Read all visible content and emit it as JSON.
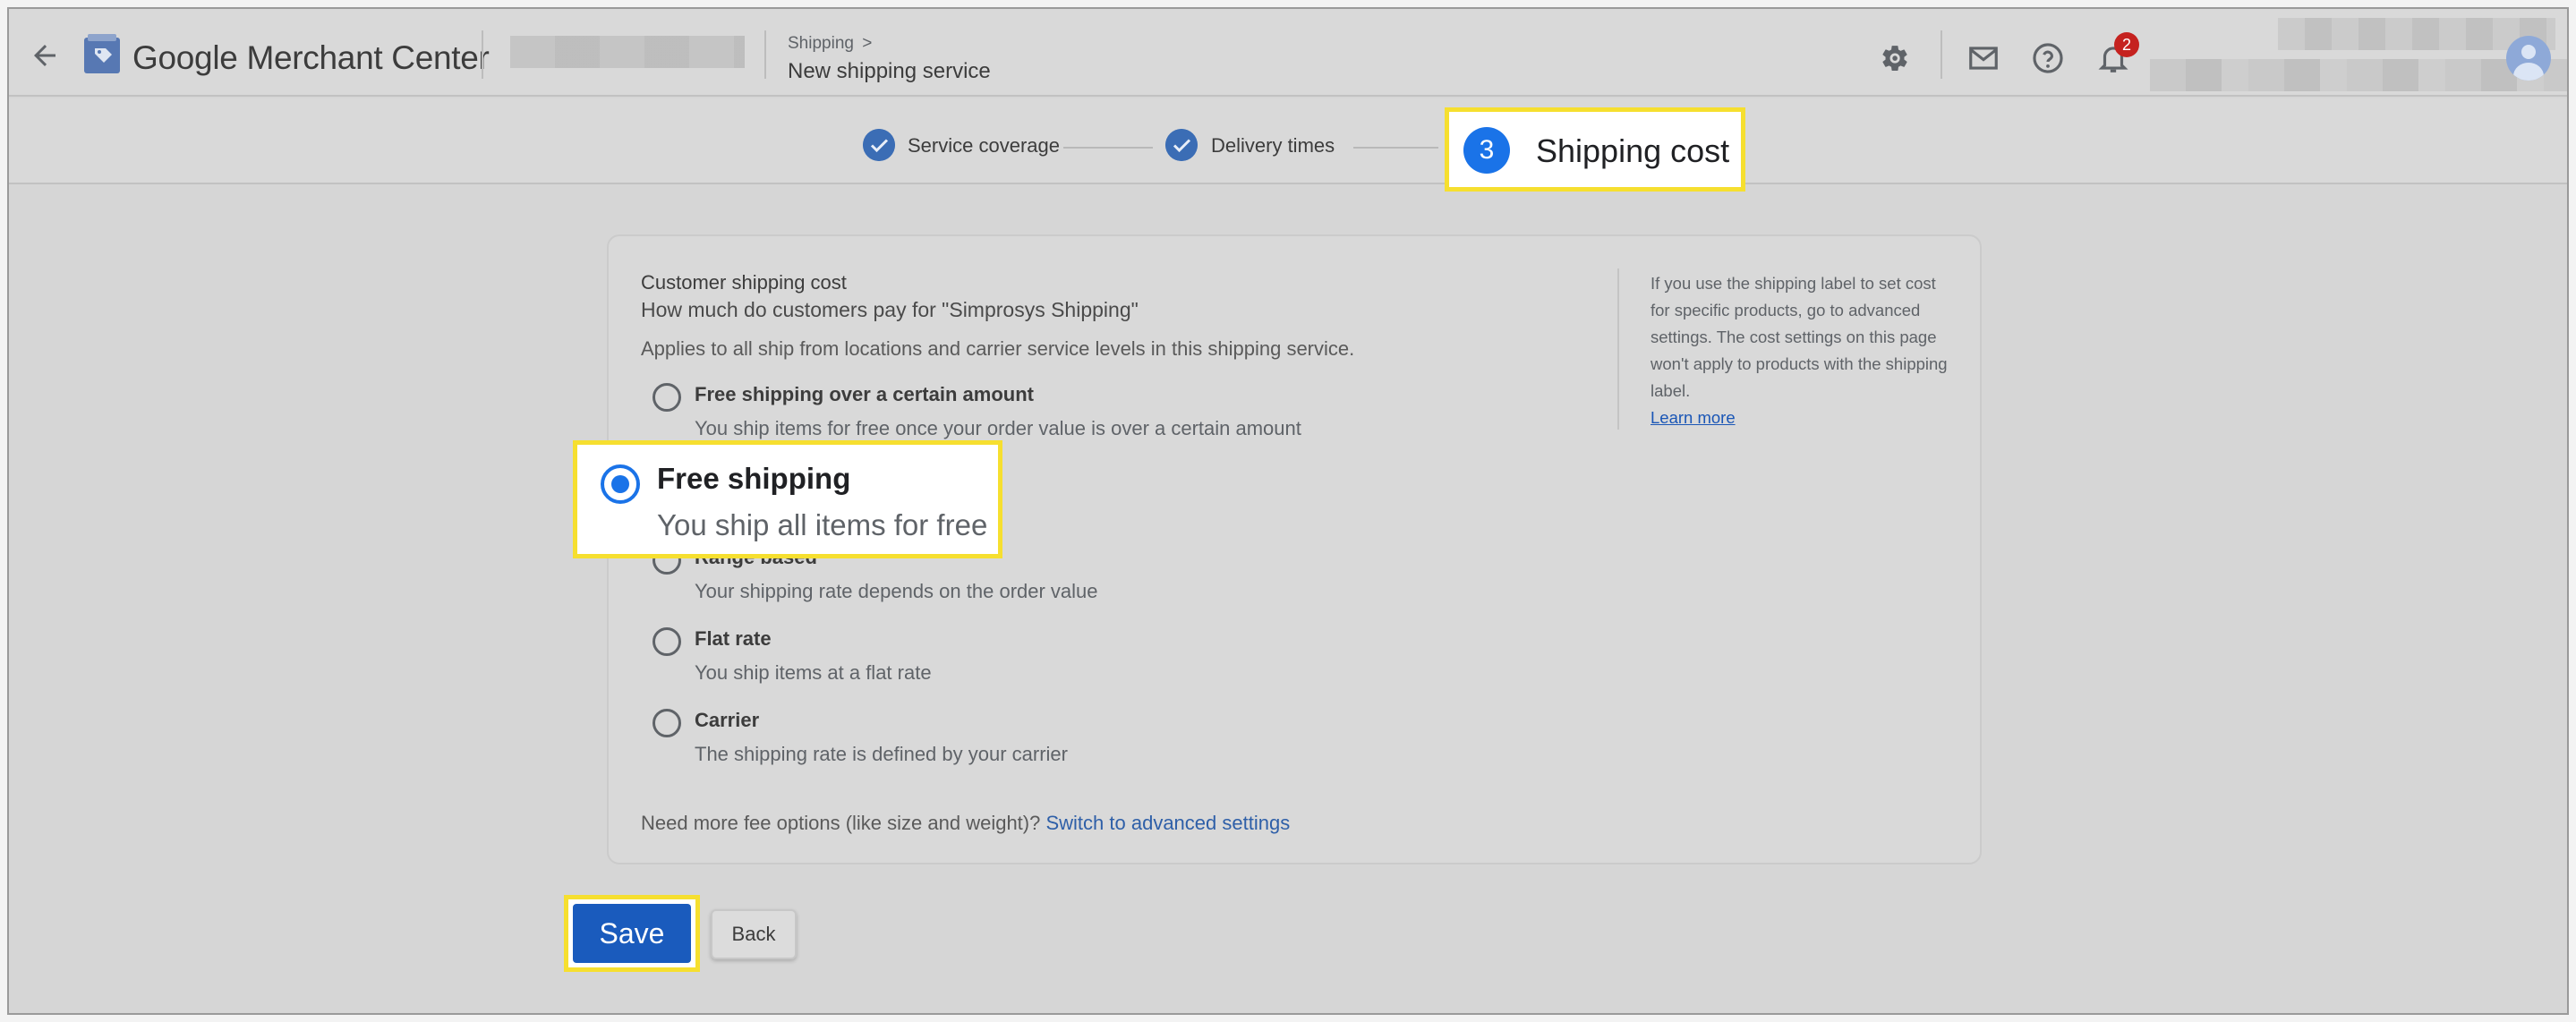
{
  "header": {
    "brand": "Google Merchant Center",
    "breadcrumb_parent": "Shipping",
    "breadcrumb_chevron": ">",
    "page_title": "New shipping service",
    "notification_count": "2",
    "icons": [
      "back-arrow-icon",
      "merchant-logo-icon",
      "settings-icon",
      "mail-icon",
      "help-icon",
      "notifications-icon",
      "avatar"
    ]
  },
  "stepper": {
    "steps": [
      {
        "label": "Service coverage",
        "state": "done"
      },
      {
        "label": "Delivery times",
        "state": "done"
      },
      {
        "label": "Shipping cost",
        "number": "3",
        "state": "current"
      }
    ]
  },
  "card": {
    "title": "Customer shipping cost",
    "subtitle": "How much do customers pay for \"Simprosys Shipping\"",
    "note": "Applies to all ship from locations and carrier service levels in this shipping service.",
    "side_text": "If you use the shipping label to set cost for specific products, go to advanced settings. The cost settings on this page won't apply to products with the shipping label.",
    "side_link": "Learn more",
    "options": [
      {
        "title": "Free shipping over a certain amount",
        "desc": "You ship items for free once your order value is over a certain amount",
        "selected": false
      },
      {
        "title": "Free shipping",
        "desc": "You ship all items for free",
        "selected": true
      },
      {
        "title": "Range based",
        "desc": "Your shipping rate depends on the order value",
        "selected": false
      },
      {
        "title": "Flat rate",
        "desc": "You ship items at a flat rate",
        "selected": false
      },
      {
        "title": "Carrier",
        "desc": "The shipping rate is defined by your carrier",
        "selected": false
      }
    ],
    "more_text": "Need more fee options (like size and weight)?",
    "more_link": "Switch to advanced settings"
  },
  "actions": {
    "save": "Save",
    "back": "Back"
  },
  "colors": {
    "accent": "#1a73e8",
    "highlight_border": "#f6df2f",
    "save_button": "#1a5bbd",
    "badge": "#c5221f"
  }
}
